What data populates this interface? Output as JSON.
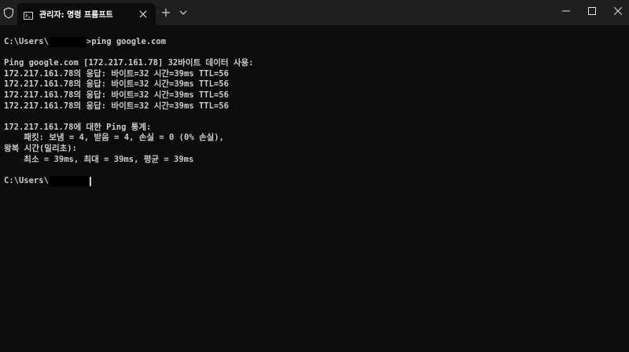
{
  "titlebar": {
    "tab_title": "관리자: 명령 프롬프트",
    "icons": {
      "shield": "shield-icon",
      "terminal": "terminal-icon",
      "close_tab": "close-icon",
      "new_tab": "plus-icon",
      "dropdown": "chevron-down-icon",
      "minimize": "minimize-icon",
      "maximize": "maximize-icon",
      "close_window": "close-icon"
    }
  },
  "console": {
    "prompt_prefix": "C:\\Users\\",
    "command_suffix": ">ping google.com",
    "ping_header": "Ping google.com [172.217.161.78] 32바이트 데이터 사용:",
    "replies": [
      "172.217.161.78의 응답: 바이트=32 시간=39ms TTL=56",
      "172.217.161.78의 응답: 바이트=32 시간=39ms TTL=56",
      "172.217.161.78의 응답: 바이트=32 시간=39ms TTL=56",
      "172.217.161.78의 응답: 바이트=32 시간=39ms TTL=56"
    ],
    "stats_header": "172.217.161.78에 대한 Ping 통계:",
    "packets": "    패킷: 보냄 = 4, 받음 = 4, 손실 = 0 (0% 손실),",
    "rtt_header": "왕복 시간(밀리초):",
    "rtt_values": "    최소 = 39ms, 최대 = 39ms, 평균 = 39ms",
    "final_prompt_prefix": "C:\\Users\\"
  },
  "colors": {
    "background": "#0c0c0c",
    "titlebar": "#1f1f1f",
    "text": "#cccccc"
  }
}
